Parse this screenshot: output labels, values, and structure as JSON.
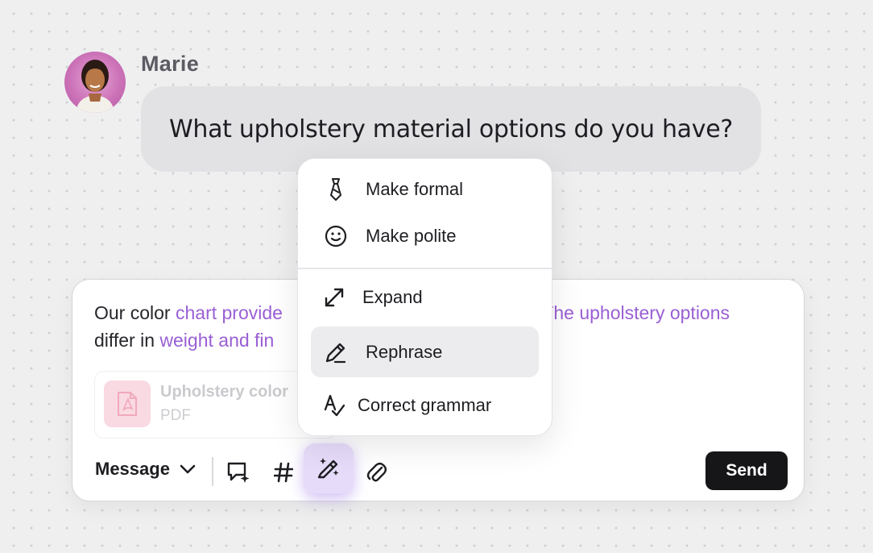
{
  "message": {
    "sender": "Marie",
    "text": "What upholstery material options do you have?"
  },
  "composer": {
    "text_line1_a": "Our color ",
    "text_line1_b": "chart provide",
    "text_line1_c": ". The upholstery options",
    "text_line2_a": "differ ",
    "text_line2_b": "in ",
    "text_line2_c": "weight and fin",
    "attachment": {
      "name": "Upholstery color",
      "type": "PDF"
    },
    "mode_label": "Message",
    "send_label": "Send"
  },
  "ai_menu": {
    "items": [
      {
        "label": "Make formal",
        "icon": "tie-icon"
      },
      {
        "label": "Make polite",
        "icon": "smile-icon"
      },
      {
        "label": "Expand",
        "icon": "expand-arrows-icon"
      },
      {
        "label": "Rephrase",
        "icon": "pencil-icon",
        "selected": true
      },
      {
        "label": "Correct grammar",
        "icon": "grammar-check-icon"
      }
    ]
  },
  "colors": {
    "highlight_text": "#9a5fd4",
    "send_button": "#161618",
    "active_tool": "#e6dcfa"
  }
}
